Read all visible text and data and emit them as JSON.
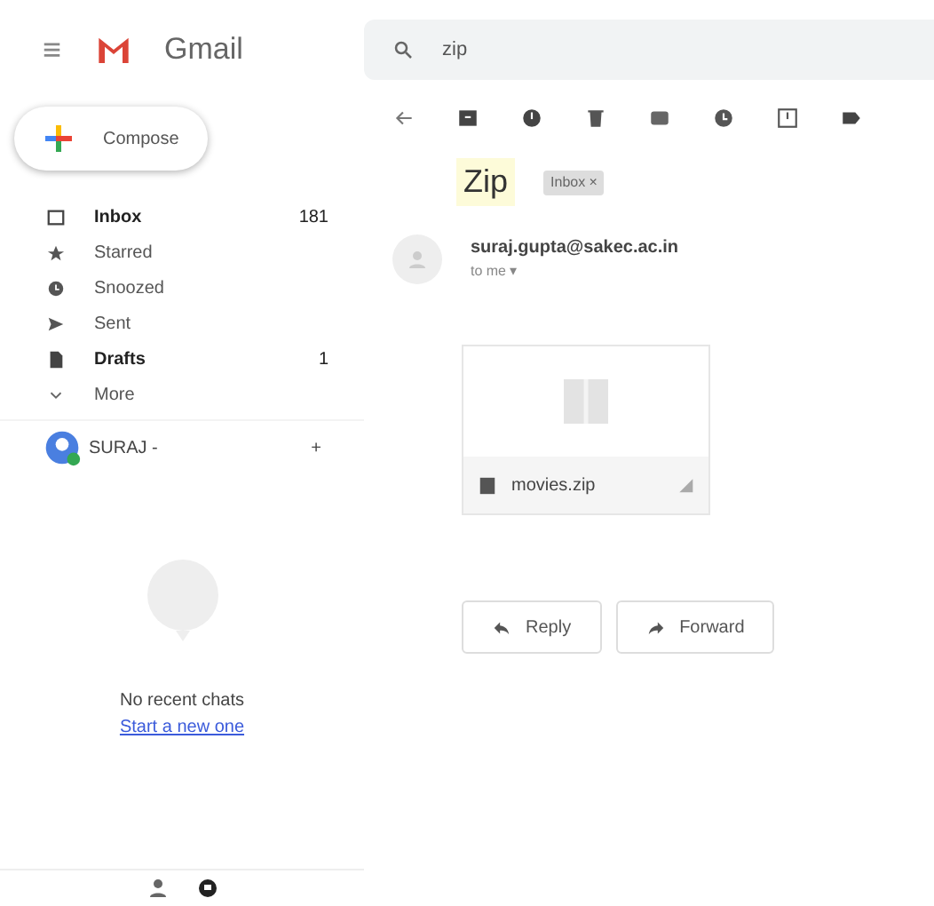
{
  "app": {
    "menu": "≡",
    "name": "Gmail"
  },
  "search": {
    "value": "zip"
  },
  "compose": {
    "label": "Compose"
  },
  "nav": [
    {
      "label": "Inbox",
      "count": "181",
      "unread": true
    },
    {
      "label": "Starred",
      "unread": false
    },
    {
      "label": "Snoozed",
      "unread": false
    },
    {
      "label": "Sent",
      "unread": false
    },
    {
      "label": "Drafts",
      "count": "1",
      "unread": true
    },
    {
      "label": "More",
      "unread": false
    }
  ],
  "account": {
    "name": "SURAJ -",
    "add": "+"
  },
  "chat": {
    "empty": "No recent chats",
    "link": "Start a new one"
  },
  "message": {
    "subject": "Zip",
    "label": "Inbox ×",
    "sender": "suraj.gupta@sakec.ac.in",
    "to": "to me ▾",
    "attachment": "movies.zip"
  },
  "actions": [
    {
      "label": "Reply",
      "kind": "reply"
    },
    {
      "label": "Forward",
      "kind": "forward"
    }
  ]
}
